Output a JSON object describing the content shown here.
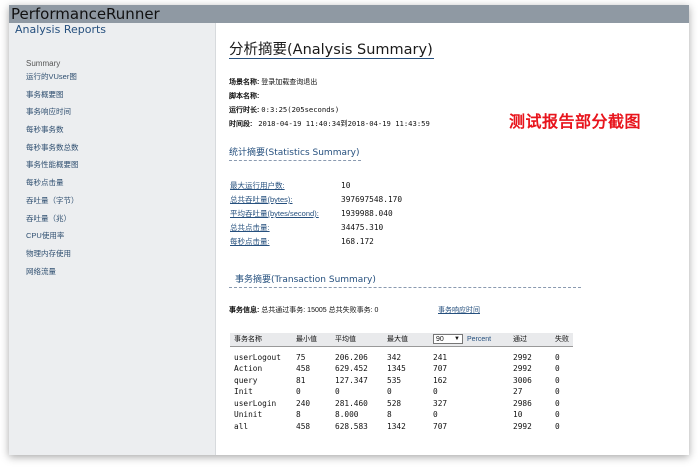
{
  "window": {
    "title": "PerformanceRunner"
  },
  "sidebar": {
    "header": "Analysis Reports",
    "items": [
      {
        "label": "Summary"
      },
      {
        "label": "运行的VUser图"
      },
      {
        "label": "事务概要图"
      },
      {
        "label": "事务响应时间"
      },
      {
        "label": "每秒事务数"
      },
      {
        "label": "每秒事务数总数"
      },
      {
        "label": "事务性能概要图"
      },
      {
        "label": "每秒点击量"
      },
      {
        "label": "吞吐量（字节）"
      },
      {
        "label": "吞吐量（兆）"
      },
      {
        "label": "CPU使用率"
      },
      {
        "label": "物理内存使用"
      },
      {
        "label": "网络流量"
      }
    ]
  },
  "main": {
    "title": "分析摘要(Analysis Summary)",
    "scenario": {
      "label": "场景名称:",
      "value": "登录加载查询退出"
    },
    "script": {
      "label": "脚本名称:",
      "value": ""
    },
    "duration": {
      "label": "运行时长:",
      "value": "0:3:25(205seconds)"
    },
    "period": {
      "label": "时间段:",
      "value": "2018-04-19 11:40:34到2018-04-19 11:43:59"
    },
    "overlay_label": "测试报告部分截图",
    "stats_section": {
      "title": "统计摘要(Statistics Summary)",
      "rows": [
        {
          "key": "最大运行用户数:",
          "value": "10"
        },
        {
          "key": "总共吞吐量(bytes):",
          "value": "397697548.170"
        },
        {
          "key": "平均吞吐量(bytes/second):",
          "value": "1939988.040"
        },
        {
          "key": "总共点击量:",
          "value": "34475.310"
        },
        {
          "key": "每秒点击量:",
          "value": "168.172"
        }
      ]
    },
    "tx_section": {
      "title": "事务摘要(Transaction Summary)",
      "info_label": "事务信息:",
      "info_text": "总共通过事务: 15005 总共失败事务: 0",
      "link": "事务响应时间",
      "columns": [
        "事务名称",
        "最小值",
        "平均值",
        "最大值",
        "90",
        "Percent",
        "通过",
        "失败"
      ],
      "percent_value": "90",
      "rows": [
        [
          "userLogout",
          "75",
          "206.206",
          "342",
          "241",
          "2992",
          "0"
        ],
        [
          "Action",
          "458",
          "629.452",
          "1345",
          "707",
          "2992",
          "0"
        ],
        [
          "query",
          "81",
          "127.347",
          "535",
          "162",
          "3006",
          "0"
        ],
        [
          "Init",
          "0",
          "0",
          "0",
          "0",
          "27",
          "0"
        ],
        [
          "userLogin",
          "240",
          "281.460",
          "528",
          "327",
          "2986",
          "0"
        ],
        [
          "Uninit",
          "8",
          "8.000",
          "8",
          "0",
          "10",
          "0"
        ],
        [
          "all",
          "458",
          "628.583",
          "1342",
          "707",
          "2992",
          "0"
        ]
      ]
    }
  }
}
